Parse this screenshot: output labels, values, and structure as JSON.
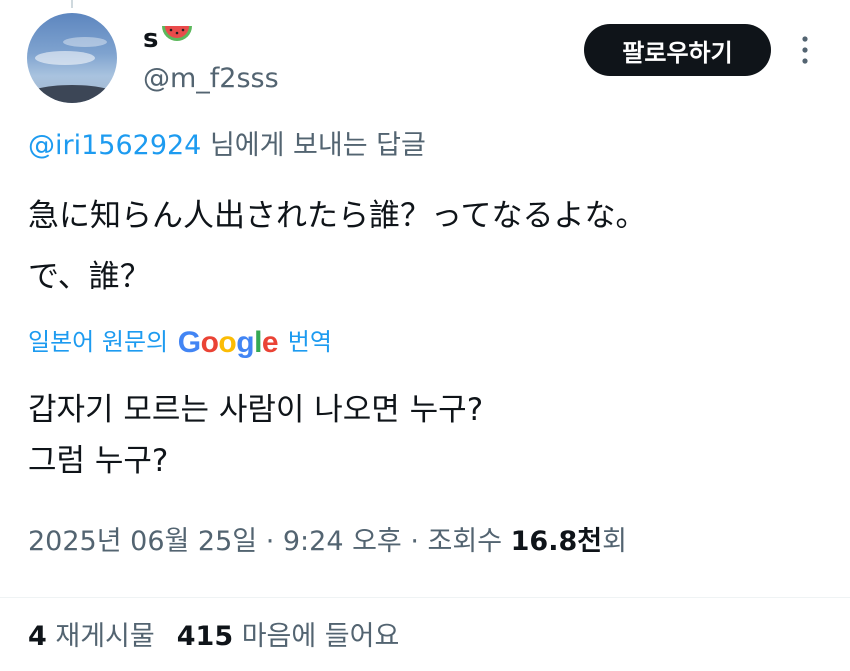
{
  "tweet": {
    "display_name": "s",
    "display_name_emoji": "watermelon-icon",
    "handle": "@m_f2sss",
    "follow_label": "팔로우하기",
    "reply_to_mention": "@iri1562924",
    "reply_to_suffix": " 님에게 보내는 답글",
    "text_lines": [
      "急に知らん人出されたら誰？ってなるよな。",
      "で、誰？"
    ],
    "translate_prefix": "일본어 원문의 ",
    "translate_brand": "Google",
    "translate_suffix": " 번역",
    "translation_lines": [
      "갑자기 모르는 사람이 나오면 누구?",
      "그럼 누구?"
    ],
    "meta": {
      "date": "2025년 06월 25일",
      "separator": " · ",
      "time": "9:24 오후",
      "views_label": "조회수 ",
      "views_count": "16.8천",
      "views_suffix": "회"
    },
    "stats": {
      "reposts_count": "4",
      "reposts_label": " 재게시물",
      "likes_count": "415",
      "likes_label": " 마음에 들어요"
    }
  },
  "colors": {
    "text": "#0f1419",
    "secondary": "#536471",
    "link": "#1d9bf0",
    "button_bg": "#0f1419"
  }
}
